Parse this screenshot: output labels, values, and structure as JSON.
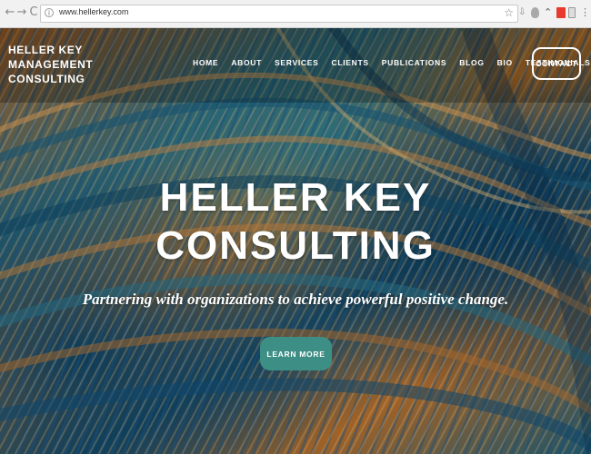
{
  "browser": {
    "back_glyph": "←",
    "forward_glyph": "→",
    "reload_glyph": "C",
    "info_glyph": "i",
    "url": "www.hellerkey.com",
    "star_glyph": "☆",
    "menu_glyph": "⋮",
    "icons": [
      "back-icon",
      "forward-icon",
      "reload-icon",
      "info-icon",
      "star-icon",
      "download-icon",
      "extension-icon",
      "menu-icon"
    ]
  },
  "site": {
    "logo_lines": [
      "HELLER KEY",
      "MANAGEMENT",
      "CONSULTING"
    ],
    "nav": [
      "HOME",
      "ABOUT",
      "SERVICES",
      "CLIENTS",
      "PUBLICATIONS",
      "BLOG",
      "BIO",
      "TESTIMONIALS"
    ],
    "contact_label": "CONTACT"
  },
  "hero": {
    "title_lines": [
      "HELLER KEY",
      "CONSULTING"
    ],
    "subtitle": "Partnering with organizations to achieve powerful positive change.",
    "cta_label": "LEARN MORE"
  },
  "colors": {
    "cta": "#3d8f86",
    "orange_wave": "#c0782d",
    "blue_wave": "#184d6a"
  }
}
